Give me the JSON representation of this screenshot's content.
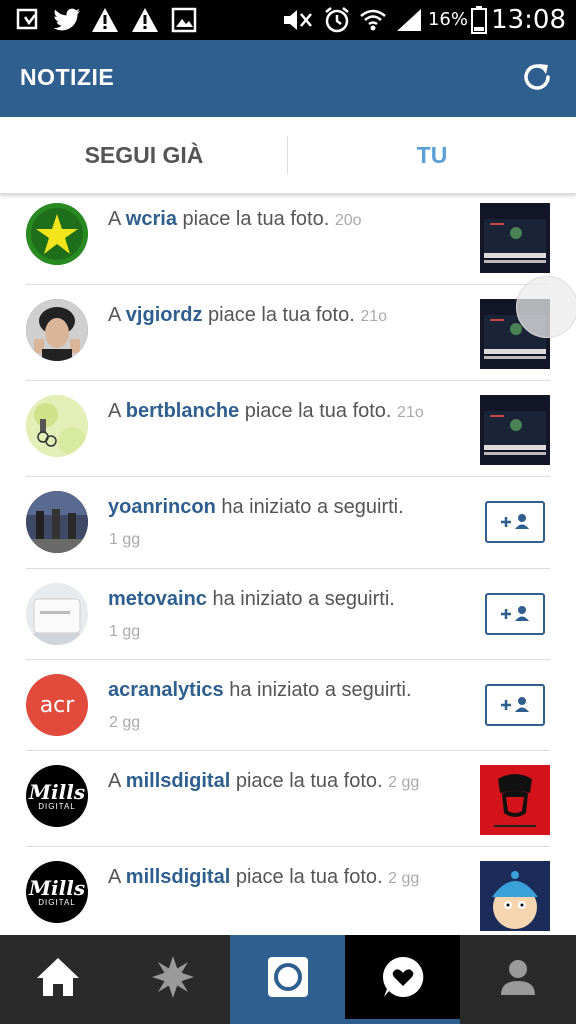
{
  "status_bar": {
    "battery_percent": "16%",
    "time": "13:08",
    "icons": [
      "download-notification-icon",
      "twitter-icon",
      "warning-icon",
      "warning-icon",
      "gallery-icon",
      "mute-icon",
      "alarm-icon",
      "wifi-icon",
      "signal-icon",
      "battery-icon"
    ]
  },
  "header": {
    "title": "NOTIZIE",
    "refresh_icon": "refresh-icon"
  },
  "tabs": [
    {
      "label": "SEGUI GIÀ"
    },
    {
      "label": "TU"
    }
  ],
  "colors": {
    "brand": "#2f5f8e",
    "active_tab": "#5aa0d6",
    "nav_active": "#2f5f8e"
  },
  "feed": [
    {
      "prefix": "A ",
      "user": "wcria",
      "action": " piace la tua foto.",
      "time": "20o",
      "kind": "like"
    },
    {
      "prefix": "A ",
      "user": "vjgiordz",
      "action": " piace la tua foto.",
      "time": "21o",
      "kind": "like"
    },
    {
      "prefix": "A ",
      "user": "bertblanche",
      "action": " piace la tua foto.",
      "time": "21o",
      "kind": "like"
    },
    {
      "prefix": "",
      "user": "yoanrincon",
      "action": " ha iniziato a seguirti.",
      "time": "1 gg",
      "kind": "follow"
    },
    {
      "prefix": "",
      "user": "metovainc",
      "action": " ha iniziato a seguirti.",
      "time": "1 gg",
      "kind": "follow"
    },
    {
      "prefix": "",
      "user": "acranalytics",
      "action": " ha iniziato a seguirti.",
      "time": "2 gg",
      "kind": "follow",
      "avatar_text": "acr"
    },
    {
      "prefix": "A ",
      "user": "millsdigital",
      "action": " piace la tua foto.",
      "time": "2 gg",
      "kind": "like",
      "avatar_logo": "Mills",
      "avatar_logo_sub": "DIGITAL"
    },
    {
      "prefix": "A ",
      "user": "millsdigital",
      "action": " piace la tua foto.",
      "time": "2 gg",
      "kind": "like",
      "avatar_logo": "Mills",
      "avatar_logo_sub": "DIGITAL"
    }
  ],
  "nav": [
    {
      "icon": "home-icon",
      "active": false
    },
    {
      "icon": "explore-icon",
      "active": false
    },
    {
      "icon": "camera-icon",
      "active": false
    },
    {
      "icon": "activity-icon",
      "active": true
    },
    {
      "icon": "profile-icon",
      "active": false
    }
  ]
}
